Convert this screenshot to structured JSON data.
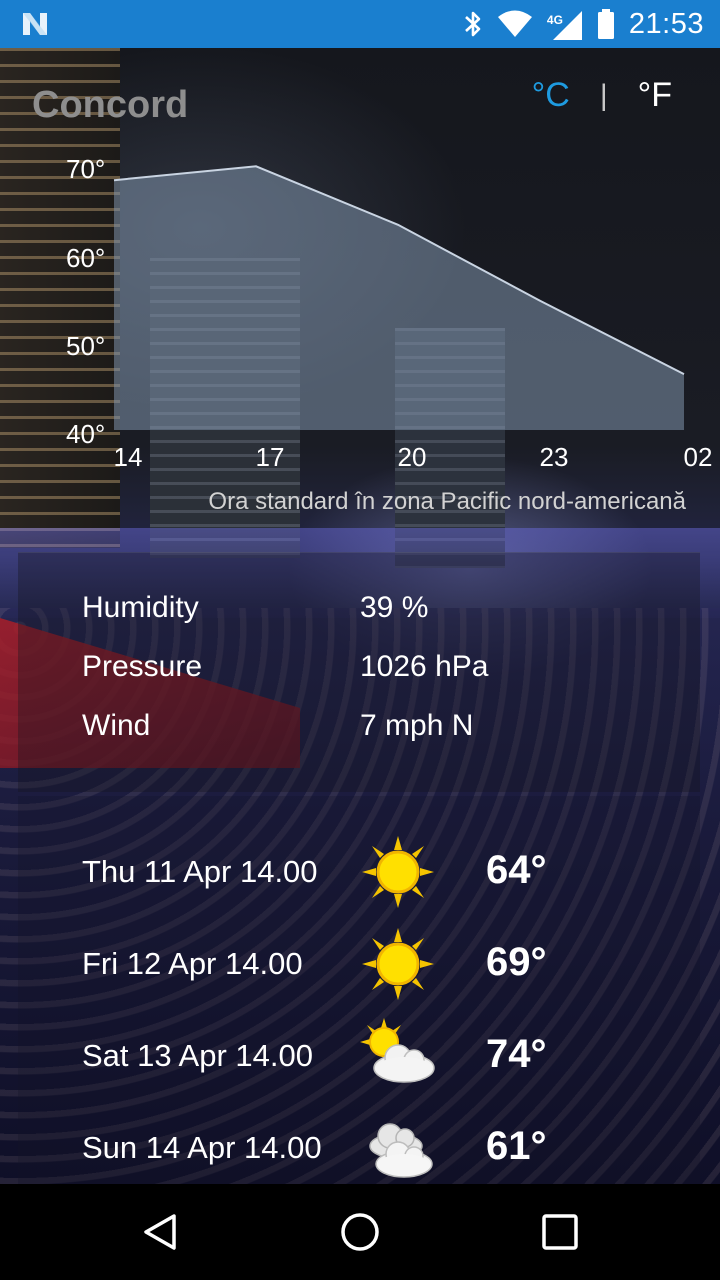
{
  "status_bar": {
    "time": "21:53",
    "network_type": "4G",
    "icons": [
      "n-logo-icon",
      "bluetooth-icon",
      "wifi-icon",
      "cell-signal-icon",
      "battery-icon"
    ]
  },
  "header": {
    "city": "Concord",
    "unit_celsius": "°C",
    "unit_separator": "|",
    "unit_fahrenheit": "°F",
    "selected_unit": "°C"
  },
  "chart_data": {
    "type": "area",
    "x": [
      "14",
      "17",
      "20",
      "23",
      "02"
    ],
    "y_ticks": [
      "70°",
      "60°",
      "50°",
      "40°"
    ],
    "ylim": [
      40,
      70
    ],
    "values": [
      68.6,
      70.2,
      63.5,
      54.8,
      46.4
    ],
    "fill_color": "#7f93ab",
    "line_color": "#c9d4e2",
    "grid": false
  },
  "timezone_label": "Ora standard în zona Pacific nord-americană",
  "details": [
    {
      "label": "Humidity",
      "value": "39 %"
    },
    {
      "label": "Pressure",
      "value": "1026 hPa"
    },
    {
      "label": "Wind",
      "value": "7 mph N"
    }
  ],
  "forecast": [
    {
      "date": "Thu 11 Apr 14.00",
      "icon": "sun-icon",
      "temp": "64°"
    },
    {
      "date": "Fri 12 Apr 14.00",
      "icon": "sun-icon",
      "temp": "69°"
    },
    {
      "date": "Sat 13 Apr 14.00",
      "icon": "sun-cloud-icon",
      "temp": "74°"
    },
    {
      "date": "Sun 14 Apr 14.00",
      "icon": "cloud-icon",
      "temp": "61°"
    }
  ],
  "colors": {
    "status_bar": "#1a7fcf",
    "accent": "#1e9be0",
    "city_text": "#8e8e8e"
  },
  "nav_bar": {
    "icons": [
      "back-icon",
      "home-icon",
      "recents-icon"
    ]
  }
}
